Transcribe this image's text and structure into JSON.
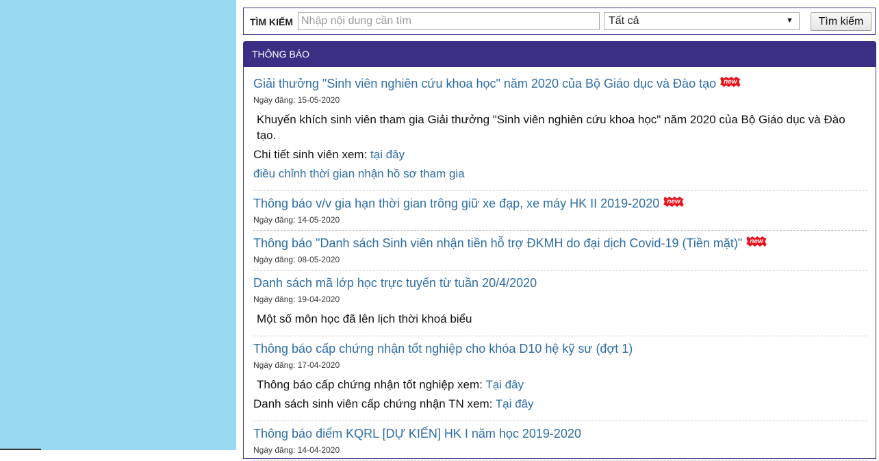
{
  "search": {
    "label": "TÌM KIẾM",
    "placeholder": "Nhập nội dung cần tìm",
    "value": "",
    "select_value": "Tất cả",
    "button_label": "Tìm kiếm"
  },
  "panel": {
    "title": "THÔNG BÁO",
    "date_prefix": "Ngày đăng:",
    "new_badge": "new"
  },
  "news": [
    {
      "title": "Giải thưởng \"Sinh viên nghiên cứu khoa học\" năm 2020 của Bộ Giáo dục và Đào tạo",
      "is_new": true,
      "date": "15-05-2020",
      "lead": "Khuyến khích sinh viên tham gia Giải thưởng \"Sinh viên nghiên cứu khoa học\" năm 2020 của Bộ Giáo dục và Đào tạo.",
      "detail_prefix": "Chi tiết sinh viên xem: ",
      "detail_link": "tại đây",
      "extra_link": "điều chỉnh thời gian nhận hồ sơ tham gia"
    },
    {
      "title": "Thông báo v/v gia hạn thời gian trông giữ xe đạp, xe máy HK II 2019-2020",
      "is_new": true,
      "date": "14-05-2020"
    },
    {
      "title": "Thông báo \"Danh sách Sinh viên nhận tiền hỗ trợ ĐKMH do đại dịch Covid-19 (Tiền mặt)\"",
      "is_new": true,
      "date": "08-05-2020"
    },
    {
      "title": "Danh sách mã lớp học trực tuyến từ tuần 20/4/2020",
      "is_new": false,
      "date": "19-04-2020",
      "lead": "Một số môn học đã lên lịch thời khoá biểu"
    },
    {
      "title": "Thông báo cấp chứng nhận tốt nghiệp cho khóa D10 hệ kỹ sư (đợt 1)",
      "is_new": false,
      "date": "17-04-2020",
      "line1_prefix": "Thông báo cấp chứng nhận tốt nghiệp xem: ",
      "line1_link": "Tại đây",
      "line2_prefix": "Danh sách sinh viên cấp chứng nhận TN xem: ",
      "line2_link": "Tại đây"
    },
    {
      "title": "Thông báo điểm KQRL [DỰ KIẾN] HK I năm học 2019-2020",
      "is_new": false,
      "date": "14-04-2020"
    }
  ],
  "colors": {
    "left_pane": "#99d9ef",
    "header_bg": "#3a2f84",
    "link": "#2e6da4",
    "badge": "#e8101a"
  }
}
